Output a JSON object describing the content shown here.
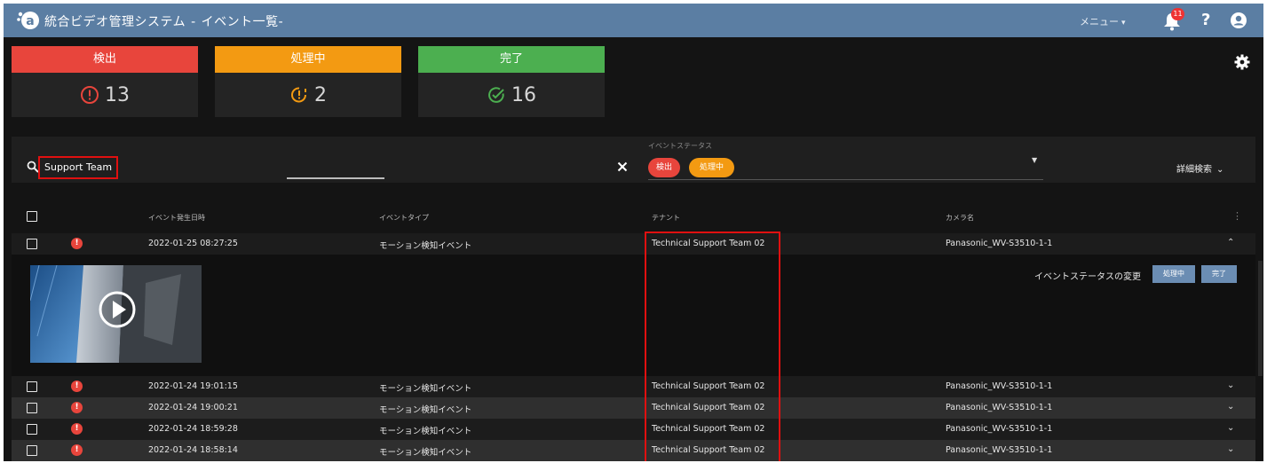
{
  "header": {
    "app_name": "統合ビデオ管理システム",
    "separator": "-",
    "page_title": "イベント一覧",
    "page_suffix": "-",
    "menu_label": "メニュー",
    "notification_count": "11"
  },
  "summary": {
    "detect": {
      "label": "検出",
      "count": "13"
    },
    "in_progress": {
      "label": "処理中",
      "count": "2"
    },
    "done": {
      "label": "完了",
      "count": "16"
    }
  },
  "filter": {
    "search_value": "Support Team",
    "status_label": "イベントステータス",
    "chips": [
      "検出",
      "処理中"
    ],
    "advanced_search_label": "詳細検索"
  },
  "table": {
    "columns": [
      "イベント発生日時",
      "イベントタイプ",
      "テナント",
      "カメラ名"
    ],
    "rows": [
      {
        "datetime": "2022-01-25 08:27:25",
        "type": "モーション検知イベント",
        "tenant": "Technical Support Team 02",
        "camera": "Panasonic_WV-S3510-1-1"
      },
      {
        "datetime": "2022-01-24 19:01:15",
        "type": "モーション検知イベント",
        "tenant": "Technical Support Team 02",
        "camera": "Panasonic_WV-S3510-1-1"
      },
      {
        "datetime": "2022-01-24 19:00:21",
        "type": "モーション検知イベント",
        "tenant": "Technical Support Team 02",
        "camera": "Panasonic_WV-S3510-1-1"
      },
      {
        "datetime": "2022-01-24 18:59:28",
        "type": "モーション検知イベント",
        "tenant": "Technical Support Team 02",
        "camera": "Panasonic_WV-S3510-1-1"
      },
      {
        "datetime": "2022-01-24 18:58:14",
        "type": "モーション検知イベント",
        "tenant": "Technical Support Team 02",
        "camera": "Panasonic_WV-S3510-1-1"
      }
    ]
  },
  "expanded": {
    "status_change_label": "イベントステータスの変更",
    "btn_in_progress": "処理中",
    "btn_done": "完了"
  },
  "colors": {
    "header_bg": "#5b7ea3",
    "detect": "#e8453c",
    "in_progress": "#f39a12",
    "done": "#4caf50",
    "highlight": "#e01010"
  },
  "icons": [
    "app-logo-icon",
    "bell-icon",
    "help-icon",
    "account-icon",
    "alert-circle-icon",
    "clock-alert-icon",
    "check-circle-icon",
    "gear-icon",
    "search-icon",
    "close-icon",
    "checkbox-icon",
    "chevron-down-icon",
    "chevron-up-icon",
    "play-icon",
    "more-vert-icon"
  ]
}
